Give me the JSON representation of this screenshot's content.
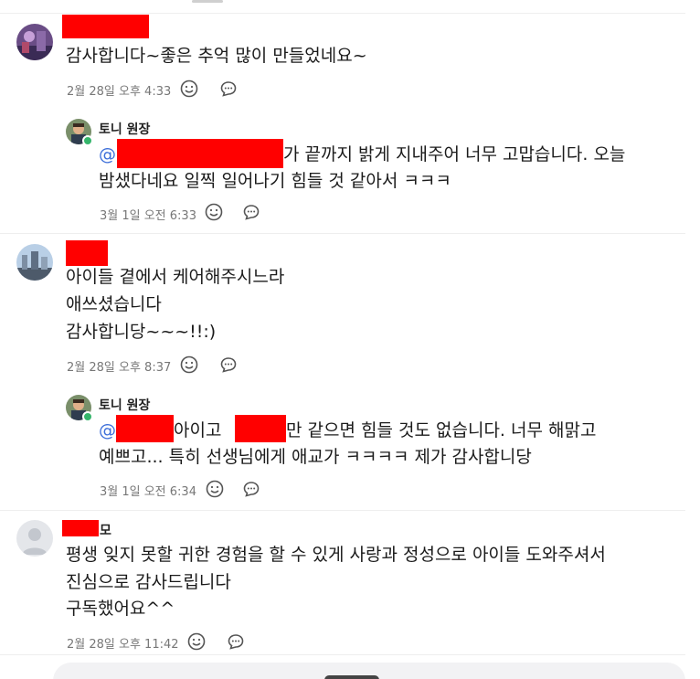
{
  "comments": [
    {
      "text_lines": [
        "감사합니다~좋은 추억 많이 만들었네요~"
      ],
      "timestamp": "2월 28일 오후 4:33"
    },
    {
      "author": "토니 원장",
      "mention": "@",
      "line1_after": "가 끝까지 밝게 지내주어 너무 고맙습니다. 오늘",
      "line2": "밤샜다네요 일찍 일어나기 힘들 것 같아서 ㅋㅋㅋ",
      "timestamp": "3월 1일 오전 6:33"
    },
    {
      "text_lines": [
        "아이들 곁에서 케어해주시느라",
        "애쓰셨습니다",
        "감사합니당~~~!!:)"
      ],
      "timestamp": "2월 28일 오후 8:37"
    },
    {
      "author": "토니 원장",
      "mention": "@",
      "line1_mid": " 아이고 ",
      "line1_after": "만 같으면 힘들 것도 없습니다. 너무 해맑고",
      "line2": "예쁘고... 특히 선생님에게 애교가 ㅋㅋㅋㅋ 제가 감사합니당",
      "timestamp": "3월 1일 오전 6:34"
    },
    {
      "author_suffix": "모",
      "text_lines": [
        "평생 잊지 못할 귀한 경험을 할 수 있게 사랑과 정성으로 아이들 도와주셔서",
        "진심으로 감사드립니다",
        "구독했어요^^"
      ],
      "timestamp": "2월 28일 오후 11:42"
    }
  ],
  "icons": {
    "emoji": "smiley-icon",
    "reply": "comment-bubble-icon"
  },
  "colors": {
    "mention": "#3d6fd9",
    "redaction": "#ff0000",
    "badge": "#35b56b"
  }
}
